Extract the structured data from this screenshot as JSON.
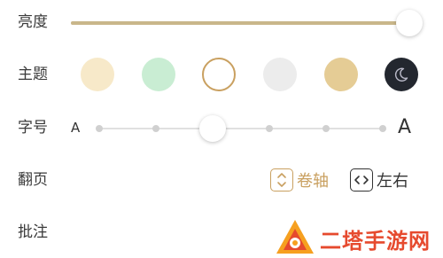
{
  "labels": {
    "brightness": "亮度",
    "theme": "主题",
    "font_size": "字号",
    "page_turn": "翻页",
    "annotation": "批注"
  },
  "brightness": {
    "level_percent": 100,
    "fill_color": "#c9b68a",
    "track_color": "#e6e6e6"
  },
  "themes": [
    {
      "color": "#f7e9c9",
      "selected": false,
      "icon": null
    },
    {
      "color": "#c9edd3",
      "selected": false,
      "icon": null
    },
    {
      "color": "#ffffff",
      "selected": true,
      "icon": null,
      "ring_color": "#c9a060"
    },
    {
      "color": "#ececec",
      "selected": false,
      "icon": null
    },
    {
      "color": "#e5cc95",
      "selected": false,
      "icon": null
    },
    {
      "color": "#23272f",
      "selected": false,
      "icon": "moon-icon"
    }
  ],
  "font_size": {
    "small_label": "A",
    "large_label": "A",
    "steps": 6,
    "selected_step": 3
  },
  "page_turn": {
    "options": [
      {
        "label": "卷轴",
        "icon": "vertical-scroll-icon",
        "selected": true,
        "color": "#c9a060"
      },
      {
        "label": "左右",
        "icon": "horizontal-swipe-icon",
        "selected": false,
        "color": "#333333"
      }
    ]
  },
  "watermark": {
    "text": "二塔手游网",
    "color": "#e64a2e"
  }
}
